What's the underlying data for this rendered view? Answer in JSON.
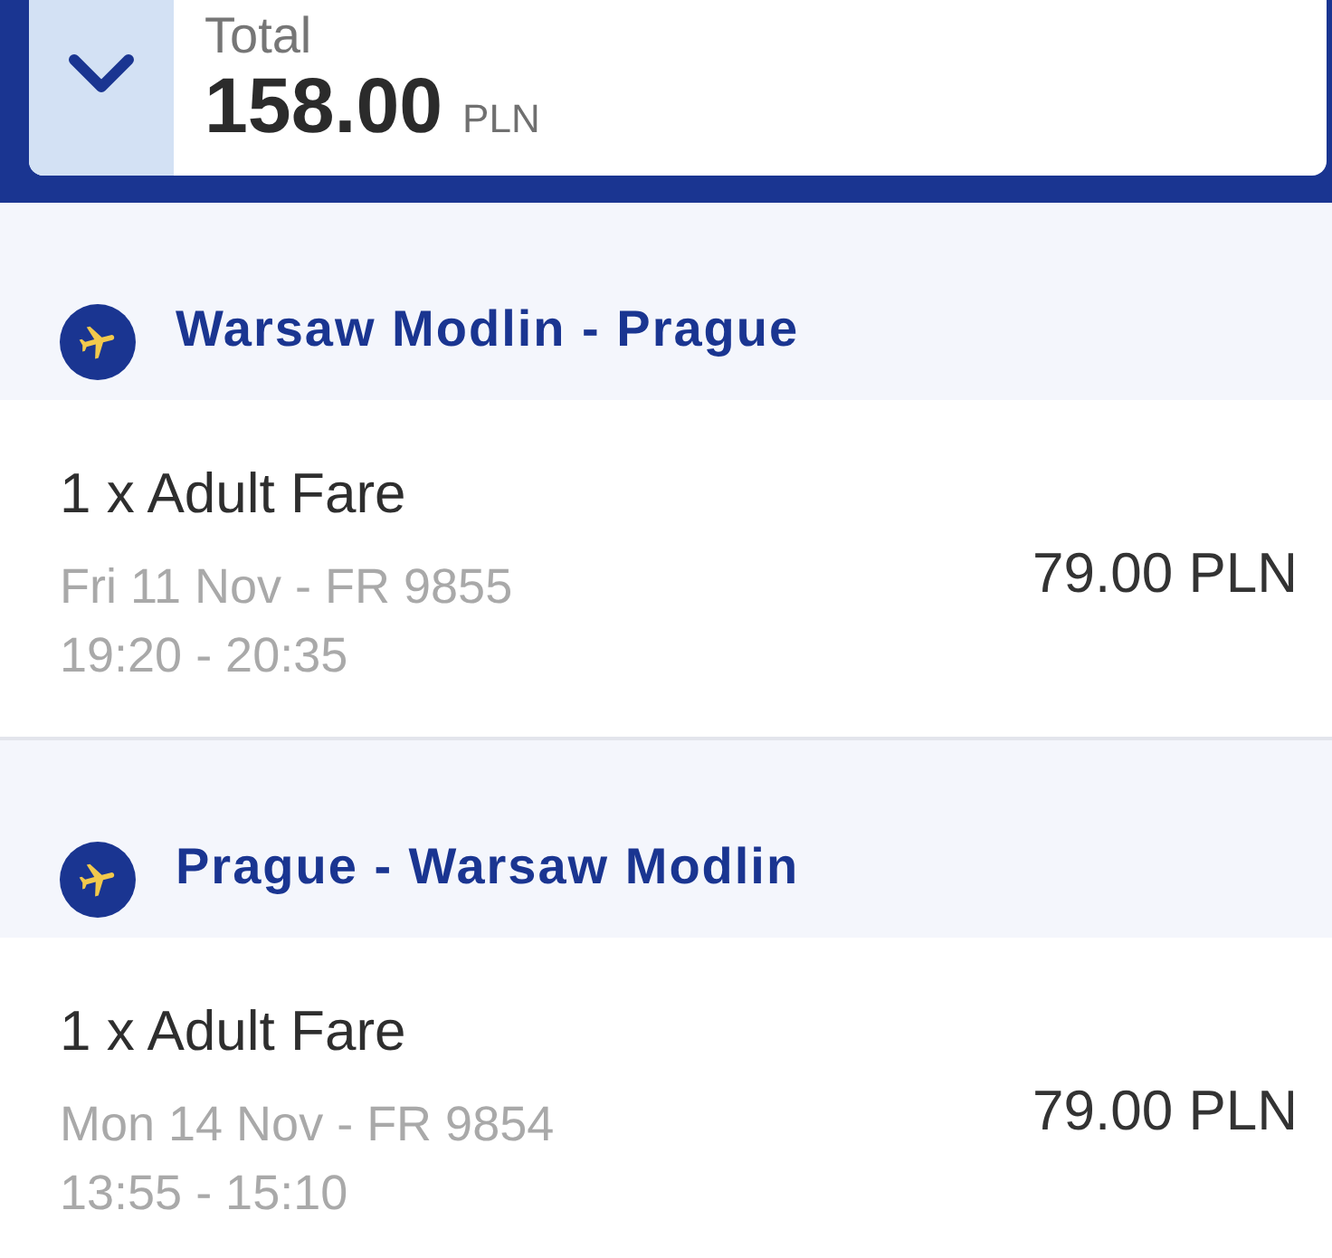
{
  "total": {
    "label": "Total",
    "amount": "158.00",
    "currency": "PLN"
  },
  "flights": [
    {
      "route": "Warsaw Modlin - Prague",
      "fare": "1 x Adult Fare",
      "date_flight": "Fri 11 Nov - FR 9855",
      "times": "19:20 - 20:35",
      "price": "79.00 PLN"
    },
    {
      "route": "Prague - Warsaw Modlin",
      "fare": "1 x Adult Fare",
      "date_flight": "Mon 14 Nov - FR 9854",
      "times": "13:55 - 15:10",
      "price": "79.00 PLN"
    }
  ]
}
